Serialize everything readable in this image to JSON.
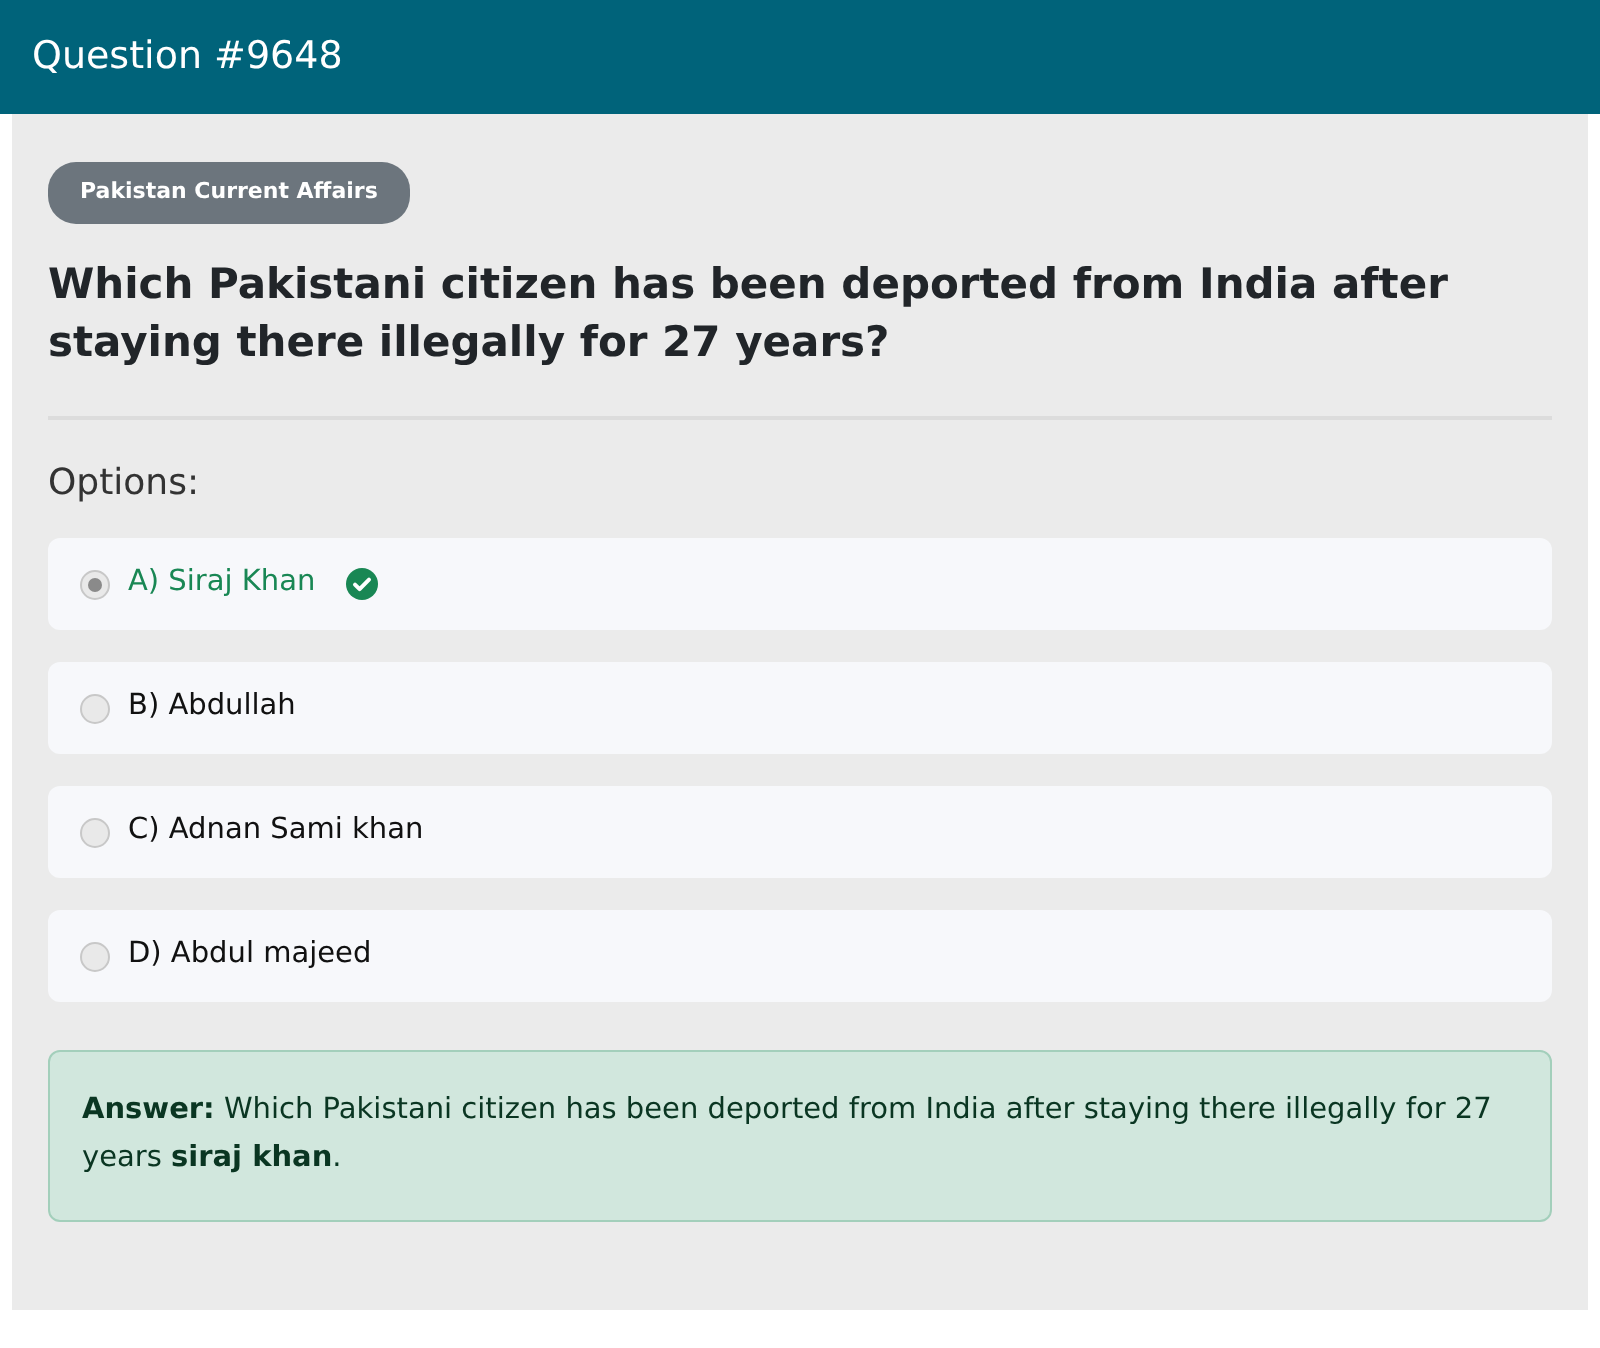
{
  "header": {
    "title": "Question #9648"
  },
  "category": "Pakistan Current Affairs",
  "question": "Which Pakistani citizen has been deported from India after staying there illegally for 27 years?",
  "options_label": "Options:",
  "options": [
    {
      "label": "A) Siraj Khan",
      "selected": true,
      "correct": true
    },
    {
      "label": "B) Abdullah",
      "selected": false,
      "correct": false
    },
    {
      "label": "C) Adnan Sami khan",
      "selected": false,
      "correct": false
    },
    {
      "label": "D) Abdul majeed",
      "selected": false,
      "correct": false
    }
  ],
  "answer": "**Answer:** Which Pakistani citizen has been deported from India after staying there illegally for 27 years **siraj khan**."
}
